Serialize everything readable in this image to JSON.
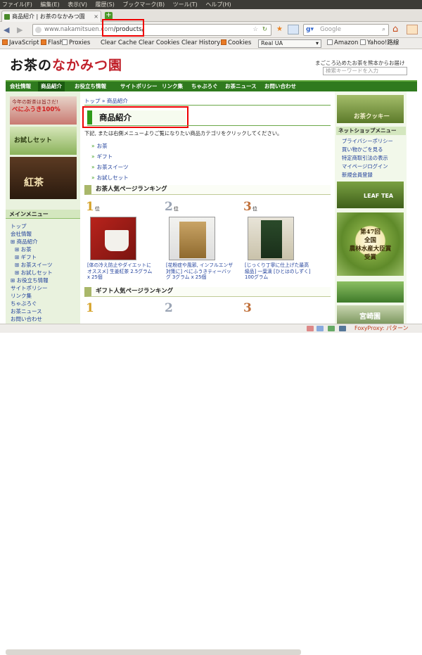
{
  "browser": {
    "menu": [
      "ファイル(F)",
      "編集(E)",
      "表示(V)",
      "履歴(S)",
      "ブックマーク(B)",
      "ツール(T)",
      "ヘルプ(H)"
    ],
    "tab_title": "商品紹介 | お茶のなかみつ園",
    "url_domain": "www.nakamitsuen.com",
    "url_path": "/products/",
    "search_placeholder": "Google",
    "bookmarks": [
      "JavaScript",
      "Flash",
      "Proxies",
      "Clear Cache",
      "Clear Cookies",
      "Clear History",
      "Cookies"
    ],
    "ua_select": "Real UA",
    "bookmarks_right": [
      "Amazon",
      "Yahoo!路線"
    ],
    "status_right": "FoxyProxy: パターン"
  },
  "site": {
    "logo_a": "お茶の",
    "logo_b": "なかみつ園",
    "tagline": "まごころ込めたお茶を熊本からお届け",
    "search_placeholder": "検索キーワードを入力",
    "nav": [
      "会社情報",
      "商品紹介",
      "お役立ち情報",
      "サイトポリシー",
      "リンク集",
      "ちゃぶろぐ",
      "お茶ニュース",
      "お問い合わせ"
    ]
  },
  "left": {
    "banner1": "今年の新茶は旨さだ!",
    "banner1b": "べにふうき100%",
    "banner2": "お試しセット",
    "banner3": "紅茶",
    "menu_title": "メインメニュー",
    "menu": [
      "トップ",
      "会社情報",
      "⊞ 商品紹介",
      "⊞ お茶",
      "⊞ ギフト",
      "⊞ お茶スイーツ",
      "⊞ お試しセット",
      "⊞ お役立ち情報",
      "サイトポリシー",
      "リンク集",
      "ちゃぶろぐ",
      "お茶ニュース",
      "お問い合わせ"
    ]
  },
  "main": {
    "breadcrumb": "トップ » 商品紹介",
    "title": "商品紹介",
    "intro": "下記, または右側メニューよりご覧になりたい商品カテゴリをクリックしてください。",
    "categories": [
      "お茶",
      "ギフト",
      "お茶スイーツ",
      "お試しセット"
    ],
    "ranking_title": "お茶人気ページランキング",
    "ranks": [
      {
        "num": "1",
        "label": "位",
        "name": "[体の冷え防止やダイエットにオススメ] 生姜紅茶 2.5グラム x 25個"
      },
      {
        "num": "2",
        "label": "位",
        "name": "[花粉症や風邪, インフルエンザ対策に] べにふうきティーバッグ 3グラム x 25個"
      },
      {
        "num": "3",
        "label": "位",
        "name": "[じっくり丁寧に仕上げた最高級品] 一葉滴 [ひとはのしずく] 100グラム"
      }
    ],
    "gift_title": "ギフト人気ページランキング",
    "gift_ranks": [
      "1",
      "2",
      "3"
    ]
  },
  "right": {
    "banner_top": "お茶クッキー",
    "shop_title": "ネットショップメニュー",
    "shop_menu": [
      "プライバシーポリシー",
      "買い物かごを見る",
      "特定商取引法の表示",
      "マイページログイン",
      "新規会員登録"
    ],
    "banner_tea": "LEAF TEA",
    "award_a": "第47回",
    "award_b": "全国",
    "award_c": "農林水産大臣賞",
    "award_d": "受賞",
    "banner_bottom": "宮崎園"
  }
}
